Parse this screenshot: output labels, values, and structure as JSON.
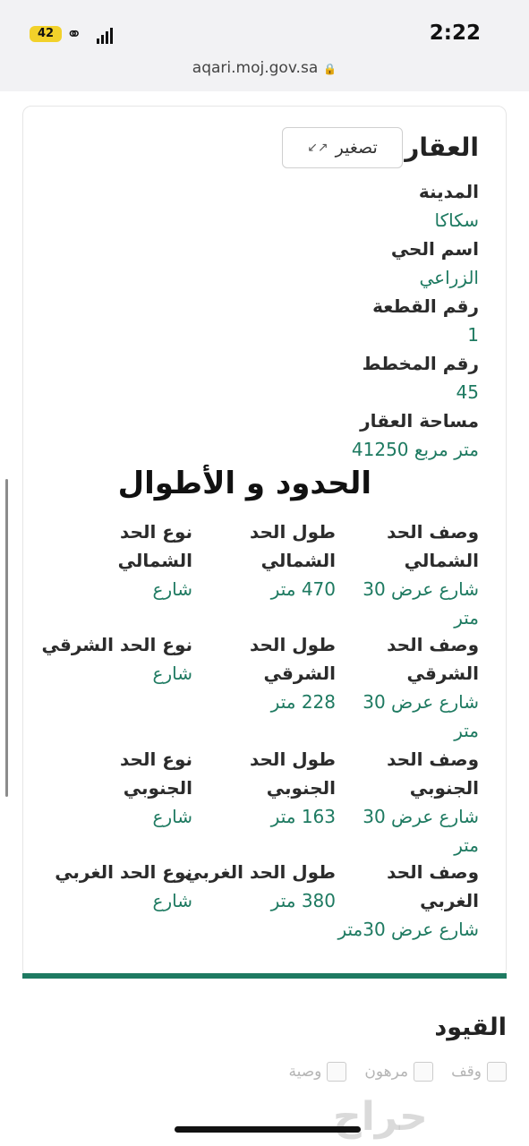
{
  "status_bar": {
    "time": "2:22",
    "battery": "42"
  },
  "browser": {
    "url": "aqari.moj.gov.sa"
  },
  "property": {
    "heading": "العقار",
    "shrink_label": "تصغير",
    "fields": [
      {
        "label": "المدينة",
        "value": "سكاكا"
      },
      {
        "label": "اسم الحي",
        "value": "الزراعي"
      },
      {
        "label": "رقم القطعة",
        "value": "1"
      },
      {
        "label": "رقم المخطط",
        "value": "45"
      },
      {
        "label": "مساحة العقار",
        "value": "41250 متر مربع"
      }
    ]
  },
  "boundaries": {
    "title": "الحدود و الأطوال",
    "north": {
      "desc_label_1": "وصف الحد",
      "desc_label_2": "الشمالي",
      "len_label_1": "طول الحد",
      "len_label_2": "الشمالي",
      "type_label_1": "نوع الحد",
      "type_label_2": "الشمالي",
      "desc_value_1": "شارع عرض 30",
      "desc_value_2": "متر",
      "len_value": "470 متر",
      "type_value": "شارع"
    },
    "east": {
      "desc_label_1": "وصف الحد",
      "desc_label_2": "الشرقي",
      "len_label_1": "طول الحد",
      "len_label_2": "الشرقي",
      "type_label": "نوع الحد الشرقي",
      "desc_value_1": "شارع عرض 30",
      "desc_value_2": "متر",
      "len_value": "228 متر",
      "type_value": "شارع"
    },
    "south": {
      "desc_label_1": "وصف الحد",
      "desc_label_2": "الجنوبي",
      "len_label_1": "طول الحد",
      "len_label_2": "الجنوبي",
      "type_label_1": "نوع الحد",
      "type_label_2": "الجنوبي",
      "desc_value_1": "شارع عرض 30",
      "desc_value_2": "متر",
      "len_value": "163 متر",
      "type_value": "شارع"
    },
    "west": {
      "desc_label_1": "وصف الحد",
      "desc_label_2": "الغربي",
      "len_label": "طول الحد الغربي",
      "type_label": "نوع الحد الغربي",
      "desc_value": "شارع عرض 30متر",
      "len_value": "380 متر",
      "type_value": "شارع"
    }
  },
  "restrictions": {
    "title": "القيود",
    "options": [
      "وقف",
      "مرهون",
      "وصية"
    ]
  },
  "watermark": "حراج",
  "colors": {
    "accent": "#1e7a61",
    "battery": "#f2d12a"
  }
}
